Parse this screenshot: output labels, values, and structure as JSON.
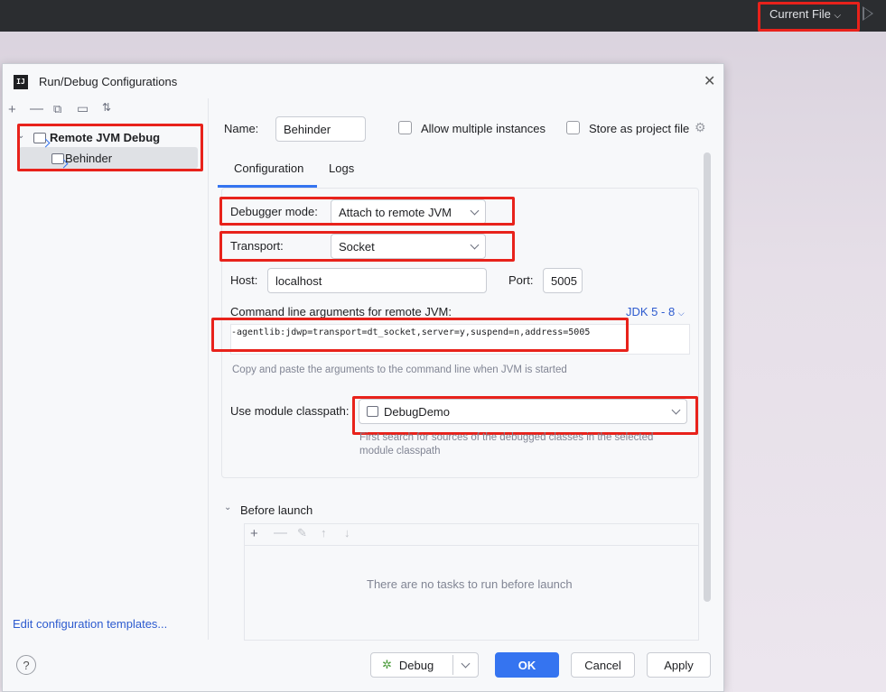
{
  "topbar": {
    "run_config": "Current File"
  },
  "dialog": {
    "title": "Run/Debug Configurations",
    "tree": {
      "group": "Remote JVM Debug",
      "item": "Behinder"
    },
    "edit_templates": "Edit configuration templates...",
    "name_label": "Name:",
    "name_value": "Behinder",
    "allow_multiple": "Allow multiple instances",
    "store_project": "Store as project file",
    "tabs": [
      "Configuration",
      "Logs"
    ],
    "debugger_mode_label": "Debugger mode:",
    "debugger_mode_value": "Attach to remote JVM",
    "transport_label": "Transport:",
    "transport_value": "Socket",
    "host_label": "Host:",
    "host_value": "localhost",
    "port_label": "Port:",
    "port_value": "5005",
    "cmd_label": "Command line arguments for remote JVM:",
    "jdk_label": "JDK 5 - 8",
    "cmd_value": "-agentlib:jdwp=transport=dt_socket,server=y,suspend=n,address=5005",
    "cmd_hint": "Copy and paste the arguments to the command line when JVM is started",
    "module_label": "Use module classpath:",
    "module_value": "DebugDemo",
    "module_hint_1": "First search for sources of the debugged classes in the selected",
    "module_hint_2": "module classpath",
    "before_launch": "Before launch",
    "no_tasks": "There are no tasks to run before launch",
    "buttons": {
      "debug": "Debug",
      "ok": "OK",
      "cancel": "Cancel",
      "apply": "Apply"
    },
    "help": "?"
  },
  "colors": {
    "accent": "#3574f0",
    "highlight": "#e8221b"
  }
}
